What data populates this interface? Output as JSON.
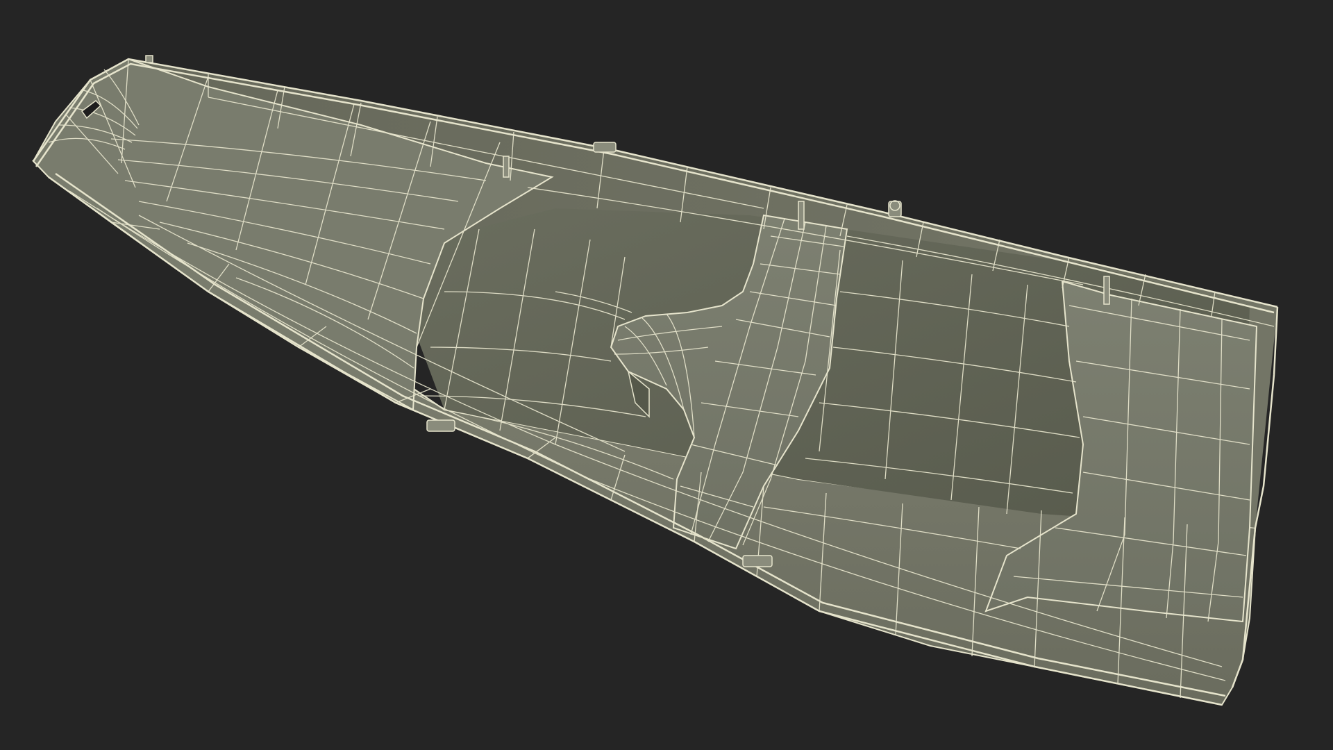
{
  "scene": {
    "subject": "boat-hull-wireframe",
    "colors": {
      "background": "#252525",
      "hull_outer": "#76786a",
      "hull_inner": "#6e7062",
      "floor": "#5f6253",
      "seat": "#7a7d6e",
      "wire": "#e6e4cc"
    }
  }
}
